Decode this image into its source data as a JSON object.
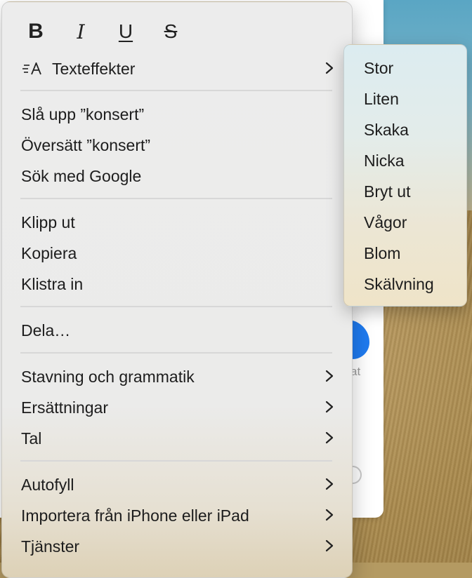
{
  "background": {
    "fragment_text": "at"
  },
  "format_bar": {
    "bold": "B",
    "italic": "I",
    "underline": "U",
    "strikethrough": "S"
  },
  "menu": {
    "text_effects": "Texteffekter",
    "look_up": "Slå upp ”konsert”",
    "translate": "Översätt ”konsert”",
    "search_google": "Sök med Google",
    "cut": "Klipp ut",
    "copy": "Kopiera",
    "paste": "Klistra in",
    "share": "Dela…",
    "spelling": "Stavning och grammatik",
    "substitutions": "Ersättningar",
    "speech": "Tal",
    "autofill": "Autofyll",
    "import_iphone": "Importera från iPhone eller iPad",
    "services": "Tjänster"
  },
  "submenu": {
    "items": [
      "Stor",
      "Liten",
      "Skaka",
      "Nicka",
      "Bryt ut",
      "Vågor",
      "Blom",
      "Skälvning"
    ]
  },
  "icons": {
    "text_effects": "text-effects-icon",
    "chevron": "chevron-right-icon"
  },
  "colors": {
    "menu_bg": "#ececec",
    "accent_blue": "#1f7bf0"
  }
}
